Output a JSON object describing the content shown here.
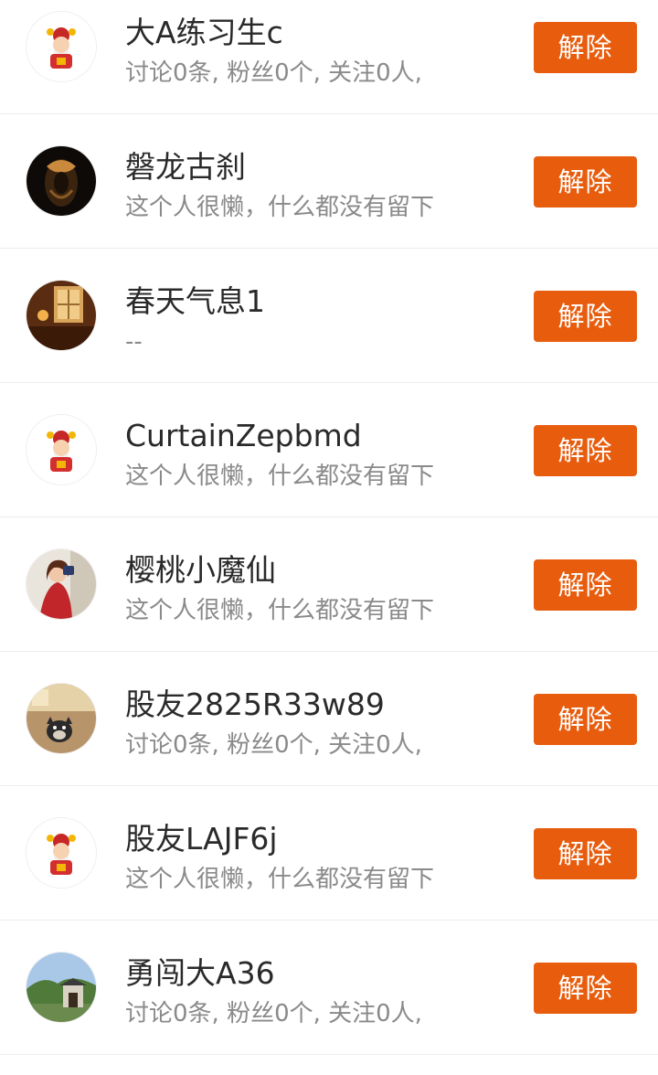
{
  "users": [
    {
      "name": "大A练习生c",
      "desc": "讨论0条, 粉丝0个, 关注0人,",
      "avatar": "caishen-avatar",
      "button": "解除"
    },
    {
      "name": "磐龙古刹",
      "desc": "这个人很懒，什么都没有留下",
      "avatar": "dark-mask-avatar",
      "button": "解除"
    },
    {
      "name": "春天气息1",
      "desc": "--",
      "avatar": "lantern-room-avatar",
      "button": "解除"
    },
    {
      "name": "CurtainZepbmd",
      "desc": "这个人很懒，什么都没有留下",
      "avatar": "caishen-avatar",
      "button": "解除"
    },
    {
      "name": "樱桃小魔仙",
      "desc": "这个人很懒，什么都没有留下",
      "avatar": "woman-red-dress-avatar",
      "button": "解除"
    },
    {
      "name": "股友2825R33w89",
      "desc": "讨论0条, 粉丝0个, 关注0人,",
      "avatar": "dog-avatar",
      "button": "解除"
    },
    {
      "name": "股友LAJF6j",
      "desc": "这个人很懒，什么都没有留下",
      "avatar": "caishen-avatar",
      "button": "解除"
    },
    {
      "name": "勇闯大A36",
      "desc": "讨论0条, 粉丝0个, 关注0人,",
      "avatar": "landscape-gate-avatar",
      "button": "解除"
    }
  ],
  "colors": {
    "button_bg": "#e85c0d",
    "name_text": "#2a2a2a",
    "desc_text": "#8a8a8a",
    "divider": "#ececec"
  }
}
